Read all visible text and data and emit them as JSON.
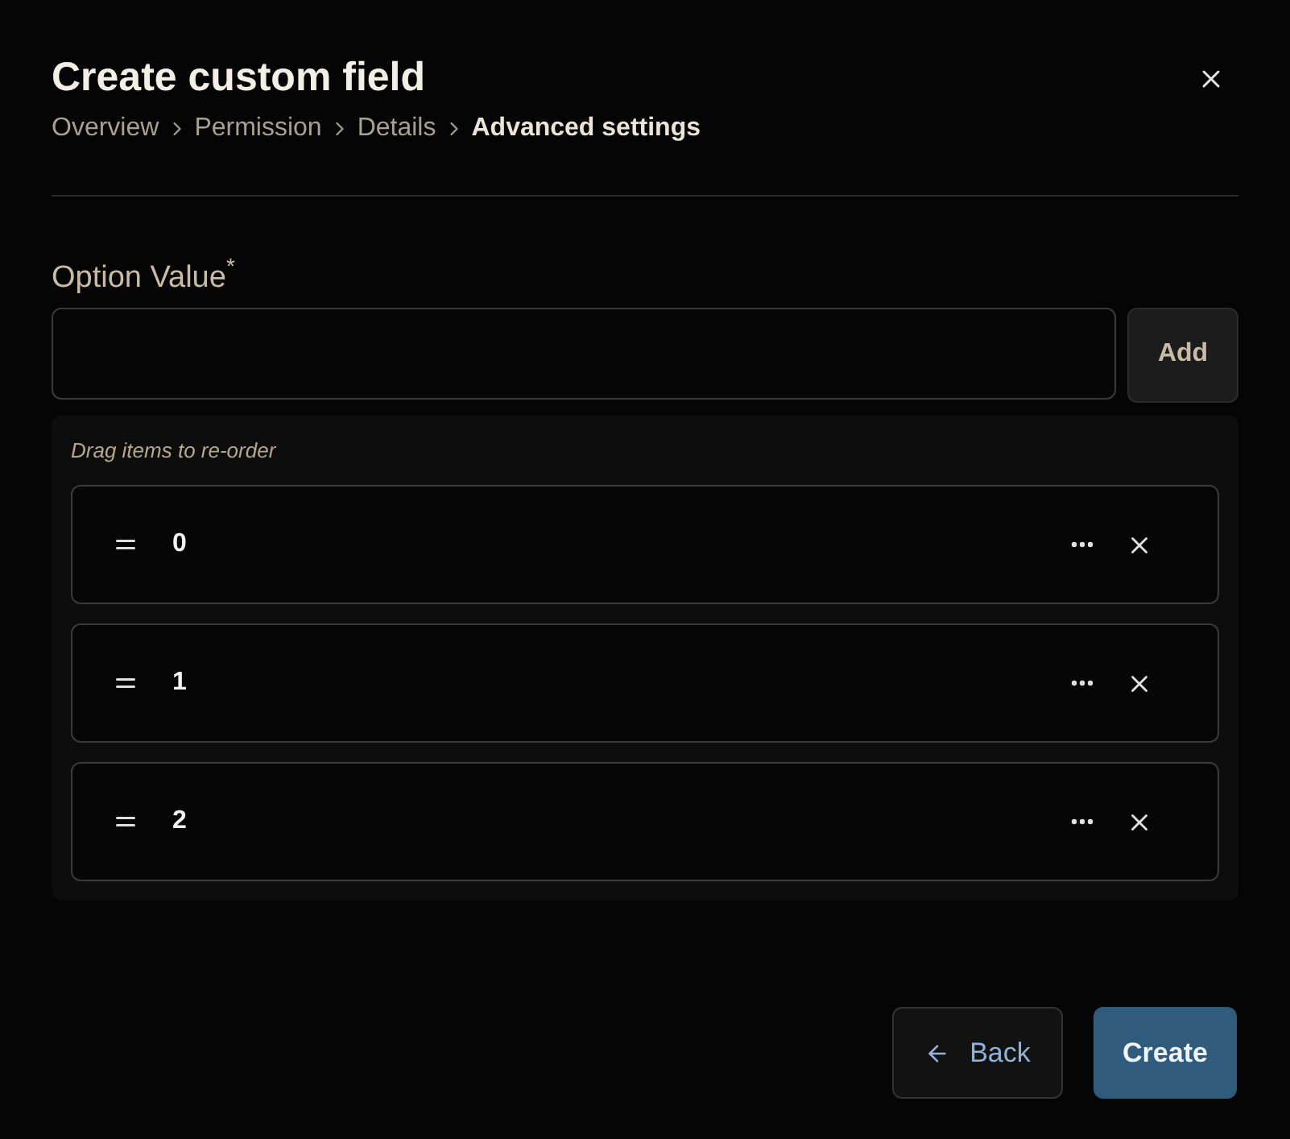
{
  "dialog": {
    "title": "Create custom field",
    "breadcrumbs": [
      {
        "label": "Overview",
        "current": false
      },
      {
        "label": "Permission",
        "current": false
      },
      {
        "label": "Details",
        "current": false
      },
      {
        "label": "Advanced settings",
        "current": true
      }
    ],
    "field": {
      "label": "Option Value",
      "required_mark": "*",
      "add_button": "Add"
    },
    "list": {
      "hint": "Drag items to re-order",
      "items": [
        {
          "value": "0"
        },
        {
          "value": "1"
        },
        {
          "value": "2"
        }
      ]
    },
    "buttons": {
      "back": "Back",
      "create": "Create"
    }
  }
}
